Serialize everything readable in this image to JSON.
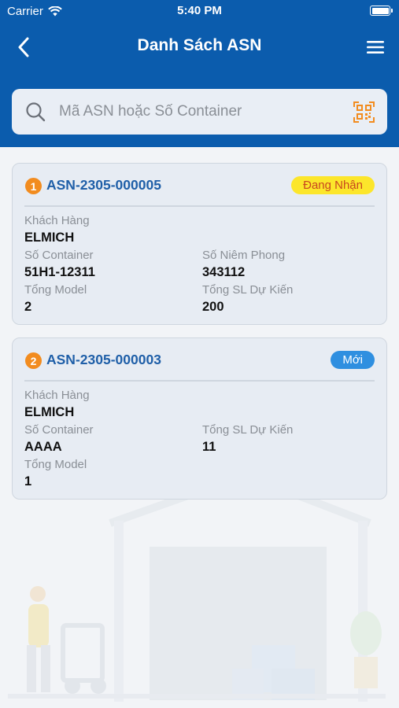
{
  "status_bar": {
    "carrier": "Carrier",
    "time": "5:40 PM"
  },
  "nav": {
    "title": "Danh Sách ASN"
  },
  "search": {
    "placeholder": "Mã ASN hoặc Số Container",
    "value": ""
  },
  "colors": {
    "header": "#0b5cad",
    "accent_orange": "#f28c1f",
    "badge_receiving": "#fce62b",
    "badge_new": "#2f8fe0",
    "link_blue": "#1f5fa8"
  },
  "asn_list": [
    {
      "index": "1",
      "code": "ASN-2305-000005",
      "status": "Đang Nhận",
      "customer_label": "Khách Hàng",
      "customer": "ELMICH",
      "container_label": "Số Container",
      "container": "51H1-12311",
      "seal_label": "Số Niêm Phong",
      "seal": "343112",
      "model_label": "Tổng Model",
      "model": "2",
      "qty_label": "Tổng SL Dự Kiến",
      "qty": "200"
    },
    {
      "index": "2",
      "code": "ASN-2305-000003",
      "status": "Mới",
      "customer_label": "Khách Hàng",
      "customer": "ELMICH",
      "container_label": "Số Container",
      "container": "AAAA",
      "qty_label": "Tổng SL Dự Kiến",
      "qty": "11",
      "model_label": "Tổng Model",
      "model": "1"
    }
  ]
}
